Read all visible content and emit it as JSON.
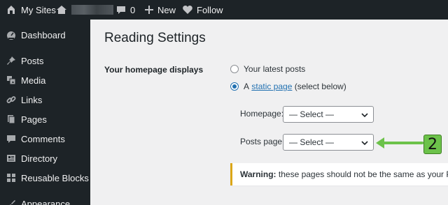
{
  "admin_bar": {
    "my_sites": "My Sites",
    "new": "New",
    "follow": "Follow"
  },
  "sidebar": {
    "items": [
      {
        "label": "Dashboard",
        "icon": "dashboard-icon"
      },
      {
        "label": "Posts",
        "icon": "pin-icon"
      },
      {
        "label": "Media",
        "icon": "media-icon"
      },
      {
        "label": "Links",
        "icon": "link-icon"
      },
      {
        "label": "Pages",
        "icon": "pages-icon"
      },
      {
        "label": "Comments",
        "icon": "comment-icon"
      },
      {
        "label": "Directory",
        "icon": "directory-icon"
      },
      {
        "label": "Reusable Blocks",
        "icon": "blocks-icon"
      },
      {
        "label": "Appearance",
        "icon": "appearance-icon"
      }
    ]
  },
  "main": {
    "title": "Reading Settings",
    "homepage_displays_label": "Your homepage displays",
    "option_latest": "Your latest posts",
    "option_static_prefix": "A",
    "option_static_link": "static page",
    "option_static_suffix": "(select below)",
    "selected_option": "static page",
    "homepage_label": "Homepage:",
    "homepage_value": "— Select —",
    "posts_page_label": "Posts page:",
    "posts_page_value": "— Select —",
    "warning_bold": "Warning:",
    "warning_text": "these pages should not be the same as your Priva"
  },
  "annotation": {
    "badge": "2",
    "color": "#6cc24a"
  },
  "colors": {
    "admin_bg": "#1d2327",
    "accent": "#2271b1",
    "warning_border": "#dba617"
  }
}
